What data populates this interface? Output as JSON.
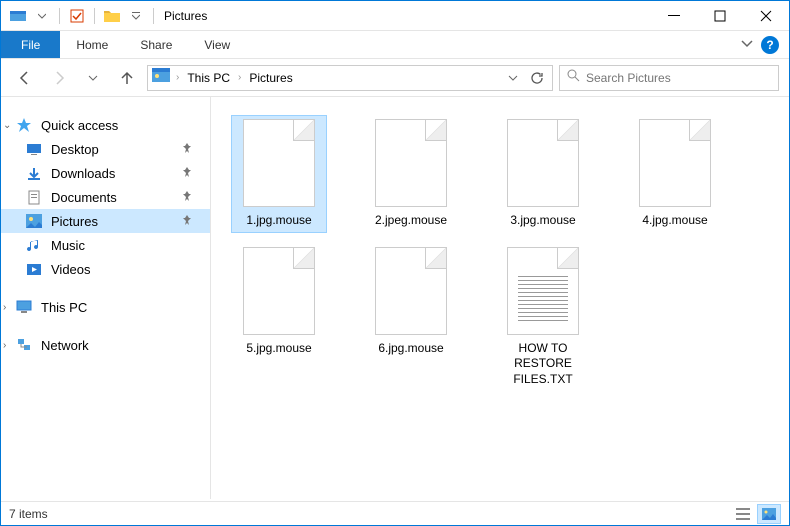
{
  "window": {
    "title": "Pictures"
  },
  "ribbon": {
    "file": "File",
    "tabs": [
      "Home",
      "Share",
      "View"
    ]
  },
  "breadcrumbs": [
    "This PC",
    "Pictures"
  ],
  "search": {
    "placeholder": "Search Pictures"
  },
  "sidebar": {
    "quick_access": "Quick access",
    "quick_items": [
      {
        "label": "Desktop",
        "icon": "desktop"
      },
      {
        "label": "Downloads",
        "icon": "downloads"
      },
      {
        "label": "Documents",
        "icon": "documents"
      },
      {
        "label": "Pictures",
        "icon": "pictures",
        "active": true
      },
      {
        "label": "Music",
        "icon": "music"
      },
      {
        "label": "Videos",
        "icon": "videos"
      }
    ],
    "this_pc": "This PC",
    "network": "Network"
  },
  "files": [
    {
      "name": "1.jpg.mouse",
      "type": "blank",
      "selected": true
    },
    {
      "name": "2.jpeg.mouse",
      "type": "blank"
    },
    {
      "name": "3.jpg.mouse",
      "type": "blank"
    },
    {
      "name": "4.jpg.mouse",
      "type": "blank"
    },
    {
      "name": "5.jpg.mouse",
      "type": "blank"
    },
    {
      "name": "6.jpg.mouse",
      "type": "blank"
    },
    {
      "name": "HOW TO RESTORE FILES.TXT",
      "type": "txt"
    }
  ],
  "status": {
    "count": "7 items"
  }
}
